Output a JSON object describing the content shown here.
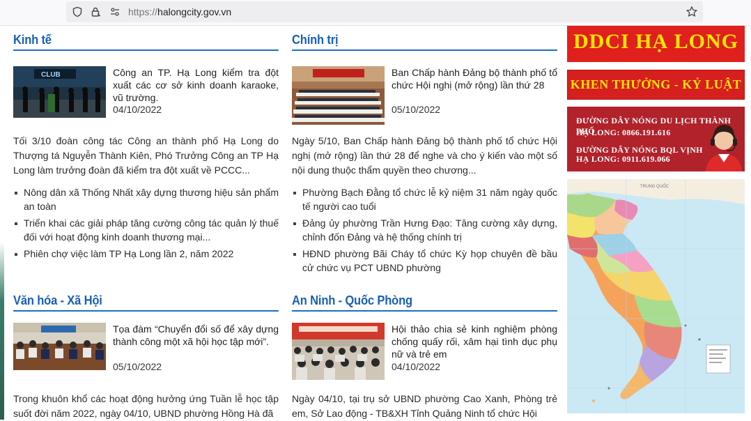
{
  "browser": {
    "url_scheme": "https://",
    "url_host": "halongcity.gov.vn"
  },
  "sections": [
    {
      "title": "Kinh tế",
      "feature_title": "Công an TP. Hạ Long kiểm tra đột xuất các cơ sở kinh doanh karaoke, vũ trường.",
      "feature_date": "04/10/2022",
      "thumb_label": "CLUB",
      "summary": "Tối 3/10 đoàn công tác Công an thành phố Hạ Long do Thượng tá Nguyễn Thành Kiên, Phó Trưởng Công an TP Hạ Long làm trưởng đoàn đã kiểm tra đột xuất về PCCC...",
      "links": [
        "Nông dân xã Thống Nhất xây dựng thương hiệu sản phẩm an toàn",
        "Triển khai các giải pháp tăng cường công tác quản lý thuế đối với hoạt động kinh doanh thương mại...",
        "Phiên chợ việc làm TP Hạ Long lần 2, năm 2022"
      ]
    },
    {
      "title": "Chính trị",
      "feature_title": "Ban Chấp hành Đảng bộ thành phố tổ chức Hội nghị (mở rộng) lần thứ 28",
      "feature_date": "05/10/2022",
      "summary": "Ngày 5/10, Ban Chấp hành Đảng bộ thành phố tổ chức Hội nghị (mở rộng) lần thứ 28 để nghe và cho ý kiến vào một số nội dung thuộc thẩm quyền theo chương...",
      "links": [
        "Phường Bạch Đằng tổ chức lễ kỷ niệm 31 năm ngày quốc tế người cao tuổi",
        "Đảng ủy phường Trần Hưng Đạo: Tăng cường xây dựng, chỉnh đốn Đảng và hệ thống chính trị",
        "HĐND phường Bãi Cháy tổ chức Kỳ họp chuyên đề bầu cử chức vụ PCT UBND phường"
      ]
    },
    {
      "title": "Văn hóa - Xã Hội",
      "feature_title": "Tọa đàm “Chuyển đổi số để xây dựng thành công một xã hội học tập mới”.",
      "feature_date": "05/10/2022",
      "summary": "Trong khuôn khổ các hoạt động hưởng ứng Tuần lễ học tập suốt đời năm 2022, ngày 04/10, UBND phường Hồng Hà đã"
    },
    {
      "title": "An Ninh - Quốc Phòng",
      "feature_title": "Hội thảo chia sẻ kinh nghiệm phòng chống quấy rối, xâm hại tình dục phụ nữ và trẻ em",
      "feature_date": "04/10/2022",
      "summary": "Ngày 04/10, tại trụ sở UBND phường Cao Xanh, Phòng trẻ em, Sở Lao động - TB&XH Tỉnh Quảng Ninh tổ chức Hội"
    }
  ],
  "sidebar": {
    "ddci": "DDCI HẠ LONG",
    "khen_thuong": "KHEN THƯỞNG - KỶ LUẬT",
    "hotline_1a": "ĐƯỜNG DÂY NÓNG DU LỊCH THÀNH PHỐ",
    "hotline_1b": "HẠ LONG: 0866.191.616",
    "hotline_2a": "ĐƯỜNG DÂY NÓNG BQL VỊNH",
    "hotline_2b": "HẠ LONG: 0911.619.066",
    "map_label": "TRUNG QUỐC"
  },
  "colors": {
    "section_title": "#1a5fb4",
    "banner_red": "#e0201c",
    "banner_yellow": "#ffe600",
    "hotline_bg": "#b1222a"
  }
}
